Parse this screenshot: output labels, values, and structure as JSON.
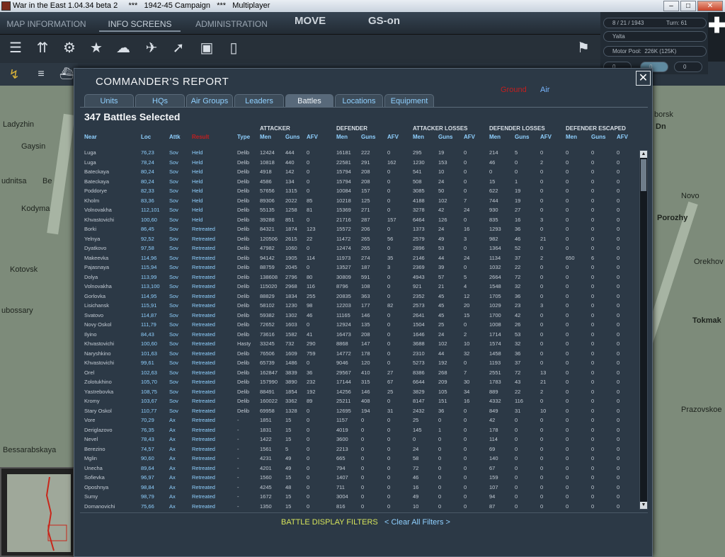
{
  "window": {
    "title": "War in the East 1.04.34 beta 2     ***   1942-45 Campaign   ***   Multiplayer",
    "minimize": "–",
    "maximize": "□",
    "close": "✕"
  },
  "topbar": {
    "tabs": [
      "MAP INFORMATION",
      "INFO SCREENS",
      "ADMINISTRATION"
    ],
    "mode": "MOVE",
    "gs": "GS-on"
  },
  "status": {
    "date": "8 / 21 / 1943",
    "turn": "Turn: 61",
    "location": "Yalta",
    "motor_pool": "Motor Pool:  226K (125K)",
    "field_a": "0",
    "field_b": "0",
    "field_c": "0"
  },
  "icons": [
    "overview-icon",
    "units-icon",
    "gear-icon",
    "star-icon",
    "weather-icon",
    "air-icon",
    "rocket-icon",
    "card-icon",
    "document-icon",
    "flag-icon"
  ],
  "map": {
    "labels": [
      "Ladyzhin",
      "Gaysin",
      "udnitsa",
      "Be",
      "Kodyma",
      "Kotovsk",
      "ubossary",
      "Bessarabskaya",
      "Porozhy",
      "Novo",
      "Orekhov",
      "Prazovskoe",
      "Tokmak",
      "borsk",
      "Dn"
    ]
  },
  "report": {
    "title": "COMMANDER'S REPORT",
    "mode_ground": "Ground",
    "mode_air": "Air",
    "close": "✕",
    "tabs": [
      "Units",
      "HQs",
      "Air Groups",
      "Leaders",
      "Battles",
      "Locations",
      "Equipment"
    ],
    "active_tab": "Battles",
    "count": "347 Battles Selected",
    "groups": [
      "ATTACKER",
      "DEFENDER",
      "ATTACKER LOSSES",
      "DEFENDER LOSSES",
      "DEFENDER ESCAPED"
    ],
    "headers": [
      "Near",
      "Loc",
      "Attk",
      "Result",
      "Type",
      "Men",
      "Guns",
      "AFV",
      "Men",
      "Guns",
      "AFV",
      "Men",
      "Guns",
      "AFV",
      "Men",
      "Guns",
      "AFV",
      "Men",
      "Guns",
      "AFV"
    ],
    "rows": [
      [
        "Luga",
        "76,23",
        "Sov",
        "Held",
        "Delib",
        "12424",
        "444",
        "0",
        "16181",
        "222",
        "0",
        "295",
        "19",
        "0",
        "214",
        "5",
        "0",
        "0",
        "0",
        "0"
      ],
      [
        "Luga",
        "78,24",
        "Sov",
        "Held",
        "Delib",
        "10818",
        "440",
        "0",
        "22581",
        "291",
        "162",
        "1230",
        "153",
        "0",
        "46",
        "0",
        "2",
        "0",
        "0",
        "0"
      ],
      [
        "Bateckaya",
        "80,24",
        "Sov",
        "Held",
        "Delib",
        "4918",
        "142",
        "0",
        "15794",
        "208",
        "0",
        "541",
        "10",
        "0",
        "0",
        "0",
        "0",
        "0",
        "0",
        "0"
      ],
      [
        "Bateckaya",
        "80,24",
        "Sov",
        "Held",
        "Delib",
        "4586",
        "134",
        "0",
        "15794",
        "208",
        "0",
        "508",
        "24",
        "0",
        "15",
        "1",
        "0",
        "0",
        "0",
        "0"
      ],
      [
        "Poddorye",
        "82,33",
        "Sov",
        "Held",
        "Delib",
        "57656",
        "1315",
        "0",
        "10084",
        "157",
        "0",
        "3085",
        "50",
        "0",
        "622",
        "19",
        "0",
        "0",
        "0",
        "0"
      ],
      [
        "Kholm",
        "83,36",
        "Sov",
        "Held",
        "Delib",
        "89306",
        "2022",
        "85",
        "10218",
        "125",
        "0",
        "4188",
        "102",
        "7",
        "744",
        "19",
        "0",
        "0",
        "0",
        "0"
      ],
      [
        "Volnovakha",
        "112,101",
        "Sov",
        "Held",
        "Delib",
        "55135",
        "1258",
        "81",
        "15369",
        "271",
        "0",
        "3278",
        "42",
        "24",
        "930",
        "27",
        "0",
        "0",
        "0",
        "0"
      ],
      [
        "Khvastovichi",
        "100,60",
        "Sov",
        "Held",
        "Delib",
        "39288",
        "851",
        "0",
        "21716",
        "287",
        "157",
        "6464",
        "126",
        "0",
        "835",
        "16",
        "3",
        "0",
        "0",
        "0"
      ],
      [
        "Borki",
        "86,45",
        "Sov",
        "Retreated",
        "Delib",
        "84321",
        "1874",
        "123",
        "15572",
        "206",
        "0",
        "1373",
        "24",
        "16",
        "1293",
        "36",
        "0",
        "0",
        "0",
        "0"
      ],
      [
        "Yelnya",
        "92,52",
        "Sov",
        "Retreated",
        "Delib",
        "120506",
        "2615",
        "22",
        "11472",
        "265",
        "56",
        "2579",
        "49",
        "3",
        "982",
        "46",
        "21",
        "0",
        "0",
        "0"
      ],
      [
        "Dyatkovo",
        "97,58",
        "Sov",
        "Retreated",
        "Delib",
        "47982",
        "1060",
        "0",
        "12474",
        "265",
        "0",
        "2896",
        "53",
        "0",
        "1364",
        "52",
        "0",
        "0",
        "0",
        "0"
      ],
      [
        "Makeevka",
        "114,96",
        "Sov",
        "Retreated",
        "Delib",
        "94142",
        "1905",
        "114",
        "11973",
        "274",
        "35",
        "2146",
        "44",
        "24",
        "1134",
        "37",
        "2",
        "650",
        "6",
        "0"
      ],
      [
        "Pajasnaya",
        "115,94",
        "Sov",
        "Retreated",
        "Delib",
        "88759",
        "2045",
        "0",
        "13527",
        "187",
        "3",
        "2369",
        "39",
        "0",
        "1032",
        "22",
        "0",
        "0",
        "0",
        "0"
      ],
      [
        "Dolya",
        "113,99",
        "Sov",
        "Retreated",
        "Delib",
        "138608",
        "2796",
        "80",
        "30809",
        "591",
        "0",
        "4943",
        "57",
        "5",
        "2664",
        "72",
        "0",
        "0",
        "0",
        "0"
      ],
      [
        "Volnovakha",
        "113,100",
        "Sov",
        "Retreated",
        "Delib",
        "115020",
        "2968",
        "116",
        "8796",
        "108",
        "0",
        "921",
        "21",
        "4",
        "1548",
        "32",
        "0",
        "0",
        "0",
        "0"
      ],
      [
        "Gorlovka",
        "114,95",
        "Sov",
        "Retreated",
        "Delib",
        "88829",
        "1834",
        "255",
        "20835",
        "363",
        "0",
        "2352",
        "45",
        "12",
        "1705",
        "36",
        "0",
        "0",
        "0",
        "0"
      ],
      [
        "Lisichansk",
        "115,91",
        "Sov",
        "Retreated",
        "Delib",
        "58102",
        "1230",
        "98",
        "12203",
        "177",
        "82",
        "2573",
        "45",
        "20",
        "1029",
        "23",
        "3",
        "0",
        "0",
        "0"
      ],
      [
        "Svatovo",
        "114,87",
        "Sov",
        "Retreated",
        "Delib",
        "59382",
        "1302",
        "46",
        "11165",
        "146",
        "0",
        "2641",
        "45",
        "15",
        "1700",
        "42",
        "0",
        "0",
        "0",
        "0"
      ],
      [
        "Novy Oskol",
        "111,79",
        "Sov",
        "Retreated",
        "Delib",
        "72652",
        "1603",
        "0",
        "12924",
        "135",
        "0",
        "1504",
        "25",
        "0",
        "1008",
        "26",
        "0",
        "0",
        "0",
        "0"
      ],
      [
        "Ilyino",
        "84,43",
        "Sov",
        "Retreated",
        "Delib",
        "73616",
        "1582",
        "41",
        "16473",
        "208",
        "0",
        "1646",
        "24",
        "2",
        "1714",
        "53",
        "0",
        "0",
        "0",
        "0"
      ],
      [
        "Khvastovichi",
        "100,60",
        "Sov",
        "Retreated",
        "Hasty",
        "33245",
        "732",
        "290",
        "8868",
        "147",
        "0",
        "3688",
        "102",
        "10",
        "1574",
        "32",
        "0",
        "0",
        "0",
        "0"
      ],
      [
        "Naryshkino",
        "101,63",
        "Sov",
        "Retreated",
        "Delib",
        "76506",
        "1609",
        "759",
        "14772",
        "178",
        "0",
        "2310",
        "44",
        "32",
        "1458",
        "36",
        "0",
        "0",
        "0",
        "0"
      ],
      [
        "Khvastovichi",
        "99,61",
        "Sov",
        "Retreated",
        "Delib",
        "65739",
        "1486",
        "0",
        "9046",
        "120",
        "0",
        "5273",
        "192",
        "0",
        "1193",
        "37",
        "0",
        "0",
        "0",
        "0"
      ],
      [
        "Orel",
        "102,63",
        "Sov",
        "Retreated",
        "Delib",
        "162847",
        "3839",
        "36",
        "29567",
        "410",
        "27",
        "8386",
        "268",
        "7",
        "2551",
        "72",
        "13",
        "0",
        "0",
        "0"
      ],
      [
        "Zolotukhino",
        "105,70",
        "Sov",
        "Retreated",
        "Delib",
        "157990",
        "3890",
        "232",
        "17144",
        "315",
        "67",
        "6644",
        "209",
        "30",
        "1783",
        "43",
        "21",
        "0",
        "0",
        "0"
      ],
      [
        "Yastrebovka",
        "108,75",
        "Sov",
        "Retreated",
        "Delib",
        "88491",
        "1854",
        "192",
        "14256",
        "146",
        "25",
        "3829",
        "105",
        "34",
        "889",
        "22",
        "2",
        "0",
        "0",
        "0"
      ],
      [
        "Kromy",
        "103,67",
        "Sov",
        "Retreated",
        "Delib",
        "160022",
        "3362",
        "89",
        "25211",
        "408",
        "0",
        "8147",
        "151",
        "16",
        "4332",
        "116",
        "0",
        "0",
        "0",
        "0"
      ],
      [
        "Stary Oskol",
        "110,77",
        "Sov",
        "Retreated",
        "Delib",
        "69958",
        "1328",
        "0",
        "12695",
        "194",
        "31",
        "2432",
        "36",
        "0",
        "849",
        "31",
        "10",
        "0",
        "0",
        "0"
      ],
      [
        "Vore",
        "70,29",
        "Ax",
        "Retreated",
        "-",
        "1851",
        "15",
        "0",
        "1157",
        "0",
        "0",
        "25",
        "0",
        "0",
        "42",
        "0",
        "0",
        "0",
        "0",
        "0"
      ],
      [
        "Deriglazovo",
        "76,35",
        "Ax",
        "Retreated",
        "-",
        "1831",
        "15",
        "0",
        "4019",
        "0",
        "0",
        "145",
        "1",
        "0",
        "178",
        "0",
        "0",
        "0",
        "0",
        "0"
      ],
      [
        "Nevel",
        "78,43",
        "Ax",
        "Retreated",
        "-",
        "1422",
        "15",
        "0",
        "3600",
        "0",
        "0",
        "0",
        "0",
        "0",
        "114",
        "0",
        "0",
        "0",
        "0",
        "0"
      ],
      [
        "Berezino",
        "74,57",
        "Ax",
        "Retreated",
        "-",
        "1561",
        "5",
        "0",
        "2213",
        "0",
        "0",
        "24",
        "0",
        "0",
        "69",
        "0",
        "0",
        "0",
        "0",
        "0"
      ],
      [
        "Mglin",
        "90,60",
        "Ax",
        "Retreated",
        "-",
        "4231",
        "49",
        "0",
        "665",
        "0",
        "0",
        "58",
        "0",
        "0",
        "140",
        "0",
        "0",
        "0",
        "0",
        "0"
      ],
      [
        "Unecha",
        "89,64",
        "Ax",
        "Retreated",
        "-",
        "4201",
        "49",
        "0",
        "794",
        "0",
        "0",
        "72",
        "0",
        "0",
        "67",
        "0",
        "0",
        "0",
        "0",
        "0"
      ],
      [
        "Sofievka",
        "96,97",
        "Ax",
        "Retreated",
        "-",
        "1560",
        "15",
        "0",
        "1407",
        "0",
        "0",
        "46",
        "0",
        "0",
        "159",
        "0",
        "0",
        "0",
        "0",
        "0"
      ],
      [
        "Oposhnya",
        "98,84",
        "Ax",
        "Retreated",
        "-",
        "4245",
        "48",
        "0",
        "711",
        "0",
        "0",
        "16",
        "0",
        "0",
        "107",
        "0",
        "0",
        "0",
        "0",
        "0"
      ],
      [
        "Sumy",
        "98,79",
        "Ax",
        "Retreated",
        "-",
        "1672",
        "15",
        "0",
        "3004",
        "0",
        "0",
        "49",
        "0",
        "0",
        "94",
        "0",
        "0",
        "0",
        "0",
        "0"
      ],
      [
        "Domanovichi",
        "75,66",
        "Ax",
        "Retreated",
        "-",
        "1350",
        "15",
        "0",
        "816",
        "0",
        "0",
        "10",
        "0",
        "0",
        "87",
        "0",
        "0",
        "0",
        "0",
        "0"
      ]
    ],
    "scroll_up": "▲",
    "scroll_down": "▼",
    "footer_filters": "BATTLE DISPLAY FILTERS",
    "footer_clear": "< Clear All Filters >"
  },
  "colors": {
    "accent_blue": "#8fd0ff",
    "result_red": "#c21f1f",
    "filter_yellow": "#d6e45a",
    "panel_bg": "#2c3946"
  }
}
